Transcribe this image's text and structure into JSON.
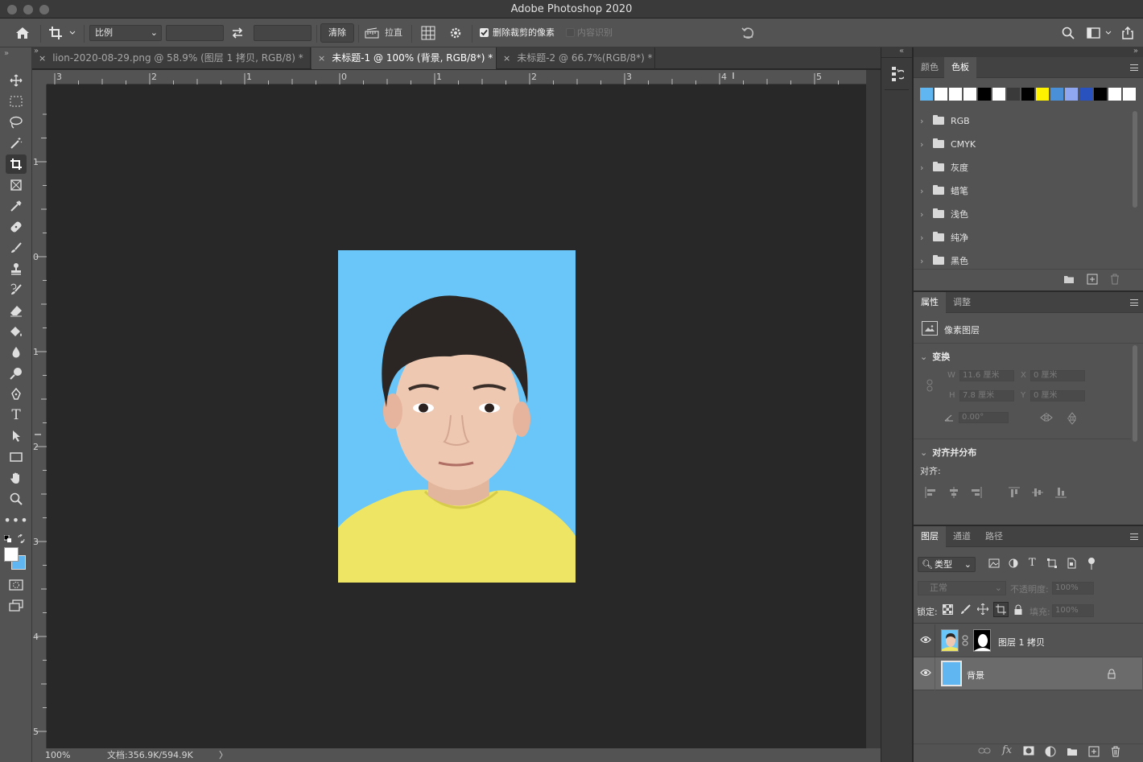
{
  "window": {
    "title": "Adobe Photoshop 2020"
  },
  "options_bar": {
    "ratio_select": "比例",
    "clear_button": "清除",
    "straighten_label": "拉直",
    "delete_cropped_label": "删除裁剪的像素",
    "delete_cropped_checked": true,
    "content_aware_label": "内容识别",
    "content_aware_checked": false
  },
  "tabs": [
    {
      "label": "lion-2020-08-29.png @ 58.9% (图层 1 拷贝, RGB/8) *",
      "close": "×",
      "active": false
    },
    {
      "label": "未标题-1 @ 100% (背景, RGB/8*) *",
      "close": "×",
      "active": true
    },
    {
      "label": "未标题-2 @ 66.7%(RGB/8*) *",
      "close": "×",
      "active": false
    }
  ],
  "ruler": {
    "horizontal": [
      "3",
      "2",
      "1",
      "0",
      "1",
      "2",
      "3",
      "4",
      "5"
    ],
    "vertical": [
      "1",
      "0",
      "1",
      "2",
      "3",
      "4",
      "5"
    ]
  },
  "status": {
    "zoom": "100%",
    "doc": "文档:356.9K/594.9K",
    "arrow": "〉"
  },
  "swatches_panel": {
    "tabs": [
      "颜色",
      "色板"
    ],
    "active_tab": "色板",
    "colors": [
      "#5fb6f1",
      "#ffffff",
      "#ffffff",
      "#ffffff",
      "#000000",
      "#ffffff",
      "#3a3a3a",
      "#000000",
      "#fff200",
      "#4a90d9",
      "#8fa6f0",
      "#2a52be",
      "#000000",
      "#ffffff",
      "#ffffff"
    ],
    "groups": [
      "RGB",
      "CMYK",
      "灰度",
      "蜡笔",
      "浅色",
      "纯净",
      "黑色"
    ]
  },
  "properties_panel": {
    "tabs": [
      "属性",
      "调整"
    ],
    "active_tab": "属性",
    "layer_type": "像素图层",
    "transform": {
      "title": "变换",
      "w_label": "W",
      "w_value": "11.6 厘米",
      "h_label": "H",
      "h_value": "7.8 厘米",
      "x_label": "X",
      "x_value": "0 厘米",
      "y_label": "Y",
      "y_value": "0 厘米",
      "angle_value": "0.00°"
    },
    "align": {
      "title": "对齐并分布",
      "label": "对齐:"
    }
  },
  "layers_panel": {
    "tabs": [
      "图层",
      "通道",
      "路径"
    ],
    "active_tab": "图层",
    "filter_select": "类型",
    "blend_mode": "正常",
    "opacity_label": "不透明度:",
    "opacity_value": "100%",
    "lock_label": "锁定:",
    "fill_label": "填充:",
    "fill_value": "100%",
    "layers": [
      {
        "name": "图层 1 拷贝",
        "visible": true,
        "has_mask": true,
        "selected": false
      },
      {
        "name": "背景",
        "visible": true,
        "locked": true,
        "selected": true
      }
    ]
  },
  "colors": {
    "canvas_bg": "#6ac6f9",
    "shirt": "#eee565",
    "accent_swatch": "#5fb6f1"
  }
}
